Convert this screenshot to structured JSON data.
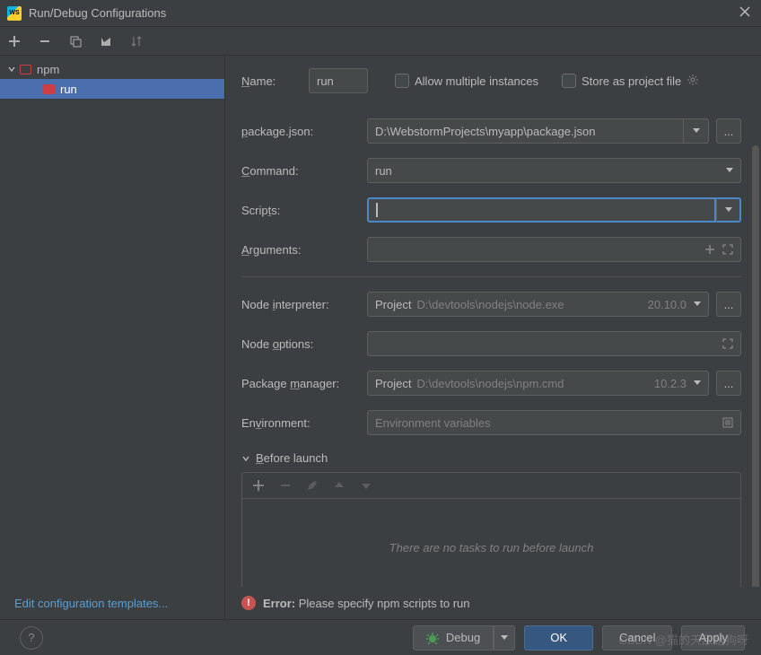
{
  "window": {
    "title": "Run/Debug Configurations"
  },
  "tree": {
    "group": "npm",
    "item": "run"
  },
  "sidebar": {
    "edit_templates": "Edit configuration templates..."
  },
  "form": {
    "name_label": "Name:",
    "name_value": "run",
    "allow_multiple": "Allow multiple instances",
    "store_as_project": "Store as project file",
    "package_json_label": "package.json:",
    "package_json_value": "D:\\WebstormProjects\\myapp\\package.json",
    "command_label": "Command:",
    "command_value": "run",
    "scripts_label": "Scripts:",
    "scripts_value": "",
    "arguments_label": "Arguments:",
    "node_interpreter_label": "Node interpreter:",
    "node_interpreter_prefix": "Project",
    "node_interpreter_path": "D:\\devtools\\nodejs\\node.exe",
    "node_interpreter_version": "20.10.0",
    "node_options_label": "Node options:",
    "package_manager_label": "Package manager:",
    "package_manager_prefix": "Project",
    "package_manager_path": "D:\\devtools\\nodejs\\npm.cmd",
    "package_manager_version": "10.2.3",
    "environment_label": "Environment:",
    "environment_placeholder": "Environment variables",
    "before_launch_label": "Before launch",
    "before_launch_empty": "There are no tasks to run before launch",
    "error_label": "Error:",
    "error_message": " Please specify npm scripts to run"
  },
  "buttons": {
    "debug": "Debug",
    "ok": "OK",
    "cancel": "Cancel",
    "apply": "Apply"
  },
  "watermark": "CSDN @猫的天敌是狗呀"
}
